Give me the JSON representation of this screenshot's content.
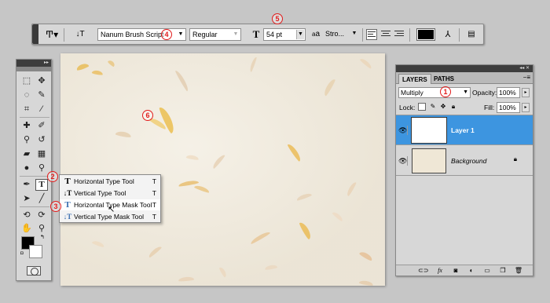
{
  "options_bar": {
    "tool_icon": "type-tool-icon",
    "orient_icon": "text-orientation-icon",
    "font_family": "Nanum Brush Script",
    "font_style": "Regular",
    "size_icon": "font-size-icon",
    "font_size": "54 pt",
    "aa_label": "a",
    "aa_mode": "Stro...",
    "text_color": "#000000",
    "warp_icon": "warp-text-icon",
    "panels_icon": "character-panel-icon"
  },
  "markers": {
    "m1": "1",
    "m2": "2",
    "m3": "3",
    "m4": "4",
    "m5": "5",
    "m6": "6"
  },
  "tools": {
    "header": "▸▸",
    "header2": "▸▸"
  },
  "flyout": {
    "items": [
      {
        "icon": "T",
        "label": "Horizontal Type Tool",
        "key": "T"
      },
      {
        "icon": "↓T",
        "label": "Vertical Type Tool",
        "key": "T"
      },
      {
        "icon": "T",
        "label": "Horizontal Type Mask Tool",
        "key": "T"
      },
      {
        "icon": "↓T",
        "label": "Vertical Type Mask Tool",
        "key": "T"
      }
    ]
  },
  "layers_panel": {
    "header": "◂◂ ✕",
    "tabs": [
      "LAYERS",
      "PATHS"
    ],
    "menu_icon": "−≡",
    "blend_mode": "Multiply",
    "opacity_label": "Opacity:",
    "opacity_value": "100%",
    "lock_label": "Lock:",
    "fill_label": "Fill:",
    "fill_value": "100%",
    "layers": [
      {
        "name": "Layer 1",
        "selected": true
      },
      {
        "name": "Background",
        "selected": false
      }
    ]
  },
  "colors": {
    "selected_layer": "#3d95e0",
    "marker": "#e21b1b",
    "canvas": "#f0e9da"
  }
}
